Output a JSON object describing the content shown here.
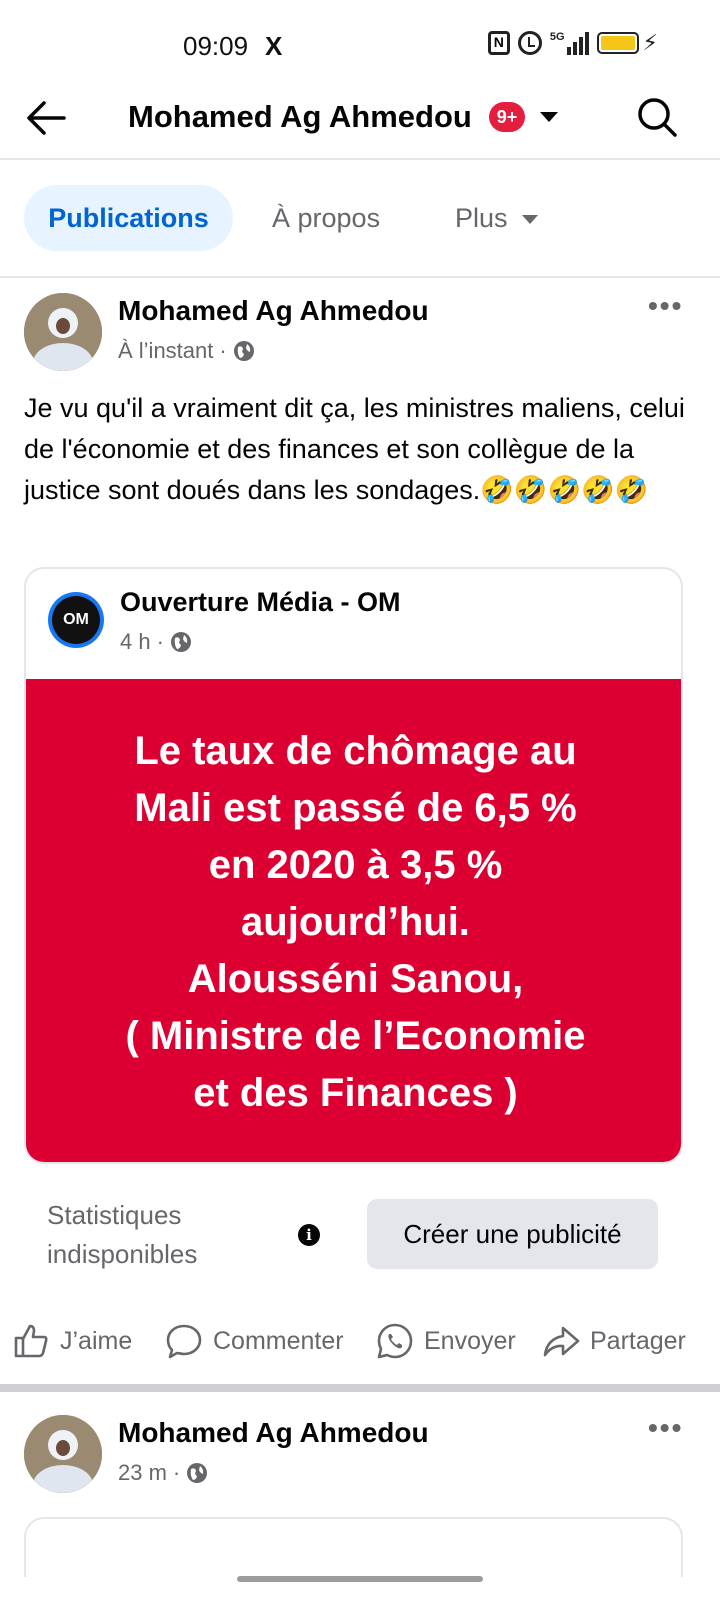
{
  "status_bar": {
    "time": "09:09",
    "x_icon": "X",
    "nfc": "N",
    "network": "5G"
  },
  "header": {
    "title": "Mohamed Ag Ahmedou",
    "badge": "9+"
  },
  "tabs": [
    {
      "label": "Publications",
      "active": true
    },
    {
      "label": "À propos",
      "active": false
    },
    {
      "label": "Plus",
      "active": false
    }
  ],
  "post": {
    "author": "Mohamed Ag Ahmedou",
    "time": "À l’instant",
    "text": "Je vu qu'il a vraiment dit ça, les ministres maliens, celui de l'économie et des finances et son collègue de la justice sont doués dans les sondages.🤣🤣🤣🤣🤣",
    "more": "•••",
    "shared": {
      "logo_text": "OM",
      "author": "Ouverture Média - OM",
      "time": "4 h",
      "banner_text": "Le taux de chômage au\nMali est passé de 6,5 %\nen 2020 à 3,5 %\naujourd’hui.\nAlousséni Sanou,\n( Ministre de l’Economie\net des Finances )",
      "banner_color": "#dc0032"
    },
    "stats_text": "Statistiques indisponibles",
    "info_icon": "i",
    "ad_button": "Créer une publicité",
    "actions": {
      "like": "J’aime",
      "comment": "Commenter",
      "send": "Envoyer",
      "share": "Partager"
    }
  },
  "next_post": {
    "author": "Mohamed Ag Ahmedou",
    "time": "23 m",
    "more": "•••"
  },
  "colors": {
    "accent": "#0064d1",
    "tab_active_bg": "#e7f3ff",
    "badge": "#e41e3f"
  }
}
